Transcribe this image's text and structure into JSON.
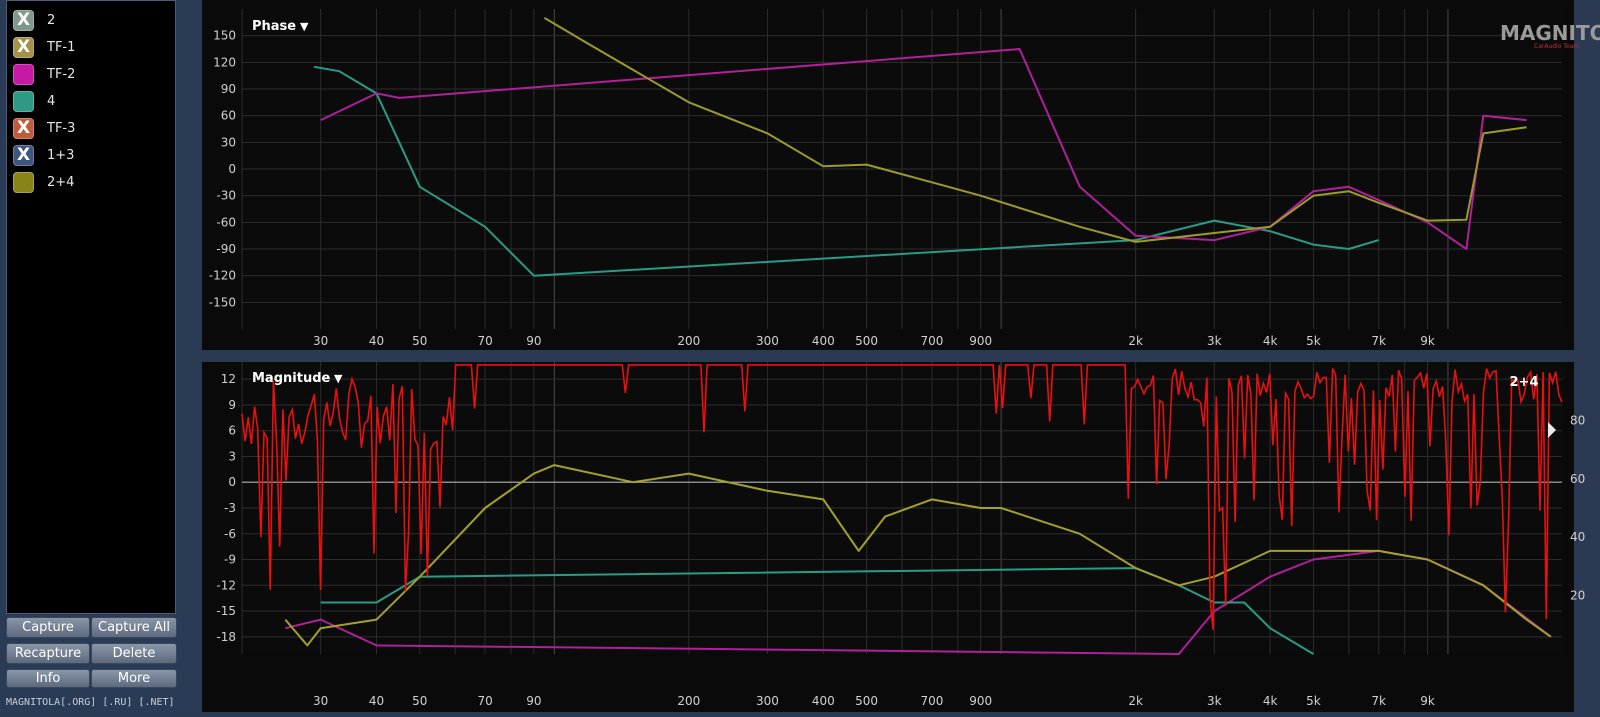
{
  "traces": [
    {
      "label": "2",
      "color": "#7f9889",
      "x": true
    },
    {
      "label": "TF-1",
      "color": "#a49048",
      "x": true
    },
    {
      "label": "TF-2",
      "color": "#c41aa6",
      "x": false
    },
    {
      "label": "4",
      "color": "#2e9a86",
      "x": false
    },
    {
      "label": "TF-3",
      "color": "#bf5c3c",
      "x": true
    },
    {
      "label": "1+3",
      "color": "#3f567f",
      "x": true
    },
    {
      "label": "2+4",
      "color": "#8a8418",
      "x": false
    }
  ],
  "x_mark": "X",
  "buttons": {
    "capture": "Capture",
    "capture_all": "Capture All",
    "recapture": "Recapture",
    "delete": "Delete",
    "info": "Info",
    "more": "More"
  },
  "footer": "MAGNITOLA[.ORG] [.RU] [.NET]",
  "logo": {
    "text": "MAGNITOLA",
    "sub": "CarAudio Team"
  },
  "phase": {
    "title": "Phase",
    "caret": "▼",
    "y_ticks": [
      150,
      120,
      90,
      60,
      30,
      0,
      -30,
      -60,
      -90,
      -120,
      -150
    ]
  },
  "magnitude": {
    "title": "Magnitude",
    "caret": "▼",
    "y_ticks": [
      12,
      9,
      6,
      3,
      0,
      -3,
      -6,
      -9,
      -12,
      -15,
      -18
    ],
    "coh_ticks": [
      80,
      60,
      40,
      20
    ],
    "badge": "2+4"
  },
  "x_ticks": [
    "30",
    "40",
    "50",
    "70",
    "90",
    "200",
    "300",
    "400",
    "500",
    "700",
    "900",
    "2k",
    "3k",
    "4k",
    "5k",
    "7k",
    "9k"
  ],
  "chart_data": [
    {
      "type": "line",
      "title": "Phase",
      "x_scale": "log",
      "ylim": [
        -180,
        180
      ],
      "x_ticks": [
        "30",
        "40",
        "50",
        "70",
        "90",
        "200",
        "300",
        "400",
        "500",
        "700",
        "900",
        "2k",
        "3k",
        "4k",
        "5k",
        "7k",
        "9k"
      ],
      "y_ticks": [
        150,
        120,
        90,
        60,
        30,
        0,
        -30,
        -60,
        -90,
        -120,
        -150
      ],
      "series": [
        {
          "name": "2+4",
          "color": "#9c9a2c",
          "points": [
            [
              95,
              170
            ],
            [
              120,
              140
            ],
            [
              200,
              75
            ],
            [
              300,
              40
            ],
            [
              400,
              3
            ],
            [
              500,
              5
            ],
            [
              700,
              -15
            ],
            [
              900,
              -30
            ],
            [
              1500,
              -65
            ],
            [
              2000,
              -82
            ],
            [
              3000,
              -72
            ],
            [
              4000,
              -65
            ],
            [
              5000,
              -30
            ],
            [
              6000,
              -25
            ],
            [
              7000,
              -38
            ],
            [
              9000,
              -58
            ],
            [
              11000,
              -57
            ],
            [
              12000,
              40
            ],
            [
              15000,
              47
            ]
          ]
        },
        {
          "name": "TF-2",
          "color": "#b0209a",
          "points": [
            [
              30,
              55
            ],
            [
              40,
              85
            ],
            [
              45,
              80
            ],
            [
              1100,
              135
            ],
            [
              1500,
              -20
            ],
            [
              2000,
              -75
            ],
            [
              3000,
              -80
            ],
            [
              4000,
              -65
            ],
            [
              5000,
              -25
            ],
            [
              6000,
              -20
            ],
            [
              7000,
              -35
            ],
            [
              9000,
              -60
            ],
            [
              11000,
              -90
            ],
            [
              12000,
              60
            ],
            [
              15000,
              55
            ]
          ]
        },
        {
          "name": "4",
          "color": "#2a9c86",
          "points": [
            [
              29,
              115
            ],
            [
              33,
              110
            ],
            [
              40,
              85
            ],
            [
              50,
              -20
            ],
            [
              70,
              -65
            ],
            [
              90,
              -120
            ],
            [
              2000,
              -80
            ],
            [
              2500,
              -68
            ],
            [
              3000,
              -58
            ],
            [
              4000,
              -70
            ],
            [
              5000,
              -85
            ],
            [
              6000,
              -90
            ],
            [
              7000,
              -80
            ]
          ]
        }
      ]
    },
    {
      "type": "line",
      "title": "Magnitude",
      "x_scale": "log",
      "ylim": [
        -20,
        14
      ],
      "y2lim": [
        0,
        100
      ],
      "y_ticks": [
        12,
        9,
        6,
        3,
        0,
        -3,
        -6,
        -9,
        -12,
        -15,
        -18
      ],
      "y2_ticks": [
        80,
        60,
        40,
        20
      ],
      "series": [
        {
          "name": "2+4",
          "color": "#a4a02e",
          "points": [
            [
              25,
              -16
            ],
            [
              28,
              -19
            ],
            [
              30,
              -17
            ],
            [
              40,
              -16
            ],
            [
              50,
              -11
            ],
            [
              70,
              -3
            ],
            [
              90,
              1
            ],
            [
              100,
              2
            ],
            [
              150,
              0
            ],
            [
              200,
              1
            ],
            [
              300,
              -1
            ],
            [
              400,
              -2
            ],
            [
              480,
              -8
            ],
            [
              550,
              -4
            ],
            [
              700,
              -2
            ],
            [
              900,
              -3
            ],
            [
              1000,
              -3
            ],
            [
              1500,
              -6
            ],
            [
              2000,
              -10
            ],
            [
              2500,
              -12
            ],
            [
              3000,
              -11
            ],
            [
              4000,
              -8
            ],
            [
              5000,
              -8
            ],
            [
              7000,
              -8
            ],
            [
              9000,
              -9
            ],
            [
              12000,
              -12
            ],
            [
              15000,
              -16
            ],
            [
              17000,
              -18
            ]
          ]
        },
        {
          "name": "4",
          "color": "#2a9c86",
          "points": [
            [
              30,
              -14
            ],
            [
              40,
              -14
            ],
            [
              50,
              -11
            ],
            [
              2000,
              -10
            ],
            [
              2500,
              -12
            ],
            [
              3000,
              -14
            ],
            [
              3500,
              -14
            ],
            [
              4000,
              -17
            ],
            [
              5000,
              -20
            ]
          ]
        },
        {
          "name": "TF-2",
          "color": "#b0209a",
          "points": [
            [
              25,
              -17
            ],
            [
              30,
              -16
            ],
            [
              40,
              -19
            ],
            [
              2500,
              -20
            ],
            [
              3000,
              -15
            ],
            [
              4000,
              -11
            ],
            [
              5000,
              -9
            ],
            [
              7000,
              -8
            ],
            [
              9000,
              -9
            ],
            [
              12000,
              -12
            ],
            [
              17000,
              -18
            ]
          ]
        }
      ]
    }
  ]
}
